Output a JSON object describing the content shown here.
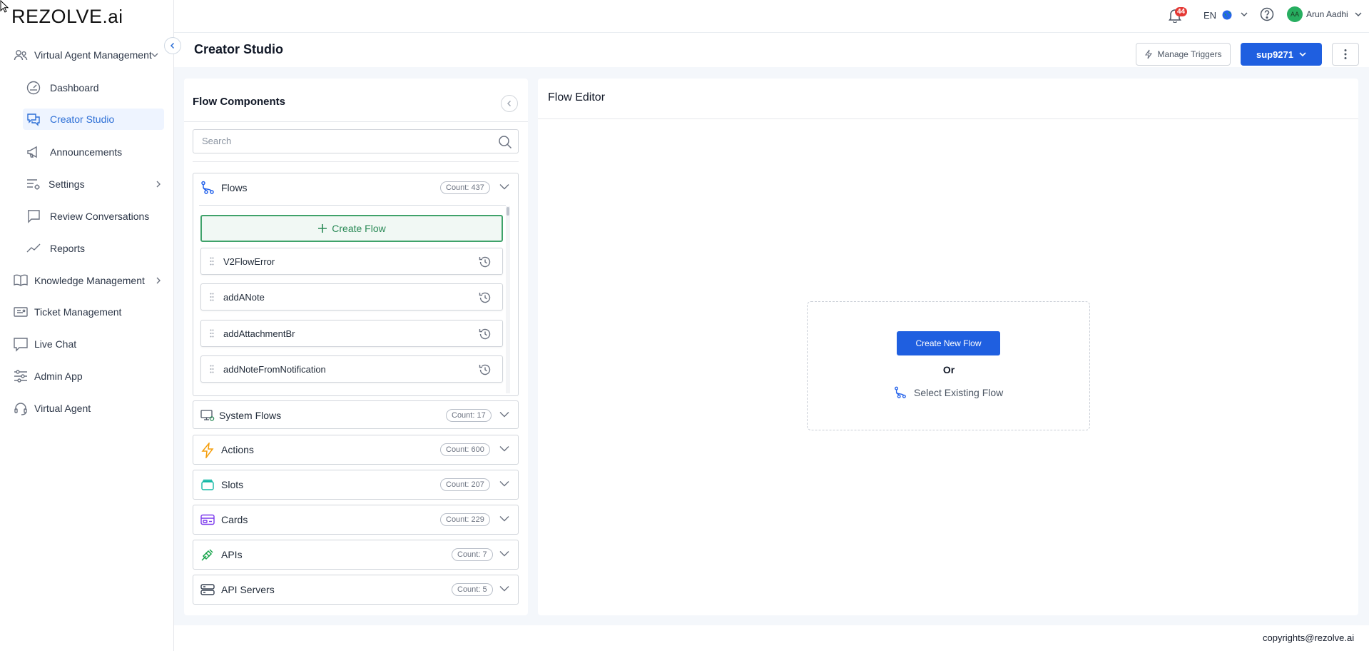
{
  "brand": {
    "logo_text": "REZOLVE",
    "logo_suffix": ".ai"
  },
  "topbar": {
    "notification_count": "44",
    "language": "EN",
    "avatar_initials": "AA",
    "user_name": "Arun Aadhi"
  },
  "sidebar": {
    "items": [
      {
        "label": "Virtual Agent Management",
        "icon": "users-icon"
      },
      {
        "label": "Dashboard",
        "icon": "gauge-icon"
      },
      {
        "label": "Creator Studio",
        "icon": "chat-bubbles-icon"
      },
      {
        "label": "Announcements",
        "icon": "megaphone-icon"
      },
      {
        "label": "Settings",
        "icon": "settings-sliders-icon"
      },
      {
        "label": "Review Conversations",
        "icon": "chat-square-icon"
      },
      {
        "label": "Reports",
        "icon": "trend-line-icon"
      },
      {
        "label": "Knowledge Management",
        "icon": "book-icon"
      },
      {
        "label": "Ticket Management",
        "icon": "ticket-icon"
      },
      {
        "label": "Live Chat",
        "icon": "chat-icon"
      },
      {
        "label": "Admin App",
        "icon": "sliders-icon"
      },
      {
        "label": "Virtual Agent",
        "icon": "headset-icon"
      }
    ]
  },
  "header": {
    "title": "Creator Studio",
    "manage_triggers": "Manage Triggers",
    "env_selector": "sup9271"
  },
  "components": {
    "title": "Flow Components",
    "search_placeholder": "Search",
    "sections": {
      "flows": {
        "label": "Flows",
        "count": "Count: 437"
      },
      "system_flows": {
        "label": "System Flows",
        "count": "Count: 17"
      },
      "actions": {
        "label": "Actions",
        "count": "Count: 600"
      },
      "slots": {
        "label": "Slots",
        "count": "Count: 207"
      },
      "cards": {
        "label": "Cards",
        "count": "Count: 229"
      },
      "apis": {
        "label": "APIs",
        "count": "Count: 7"
      },
      "api_servers": {
        "label": "API Servers",
        "count": "Count: 5"
      }
    },
    "create_flow": "Create Flow",
    "flow_items": [
      "V2FlowError",
      "addANote",
      "addAttachmentBr",
      "addNoteFromNotification"
    ]
  },
  "editor": {
    "title": "Flow Editor",
    "create_new_flow": "Create New Flow",
    "or": "Or",
    "select_existing": "Select Existing Flow"
  },
  "footer": {
    "copyright": "copyrights@rezolve.ai"
  },
  "colors": {
    "primary": "#1f5fe0",
    "success": "#3fa26a",
    "active_nav": "#2d6fd6",
    "badge": "#e53935"
  }
}
